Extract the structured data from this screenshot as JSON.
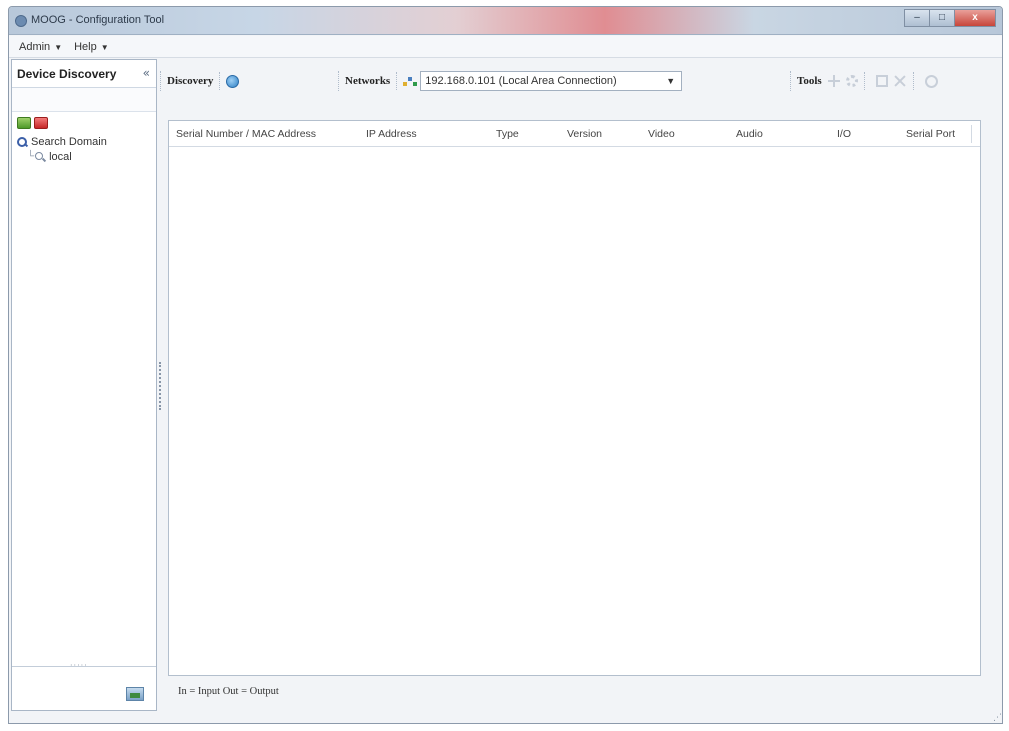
{
  "window": {
    "title": "MOOG - Configuration Tool",
    "controls": [
      "–",
      "□",
      "x"
    ]
  },
  "menu": {
    "items": [
      {
        "label": "Admin",
        "caret": "▼"
      },
      {
        "label": "Help",
        "caret": "▼"
      }
    ]
  },
  "left_panel": {
    "title": "Device Discovery",
    "collapse": "«",
    "tree": {
      "root": "Search Domain",
      "child": "local"
    },
    "grip": "·····"
  },
  "toolbar": {
    "discovery_label": "Discovery",
    "networks_label": "Networks",
    "network_selected": "192.168.0.101 (Local Area Connection)",
    "dropdown_caret": "▼",
    "tools_label": "Tools"
  },
  "table": {
    "columns": [
      "Serial Number / MAC Address",
      "IP Address",
      "Type",
      "Version",
      "Video",
      "Audio",
      "I/O",
      "Serial Port"
    ],
    "rows": []
  },
  "legend": "In = Input   Out = Output",
  "resize_grip": "⋰"
}
